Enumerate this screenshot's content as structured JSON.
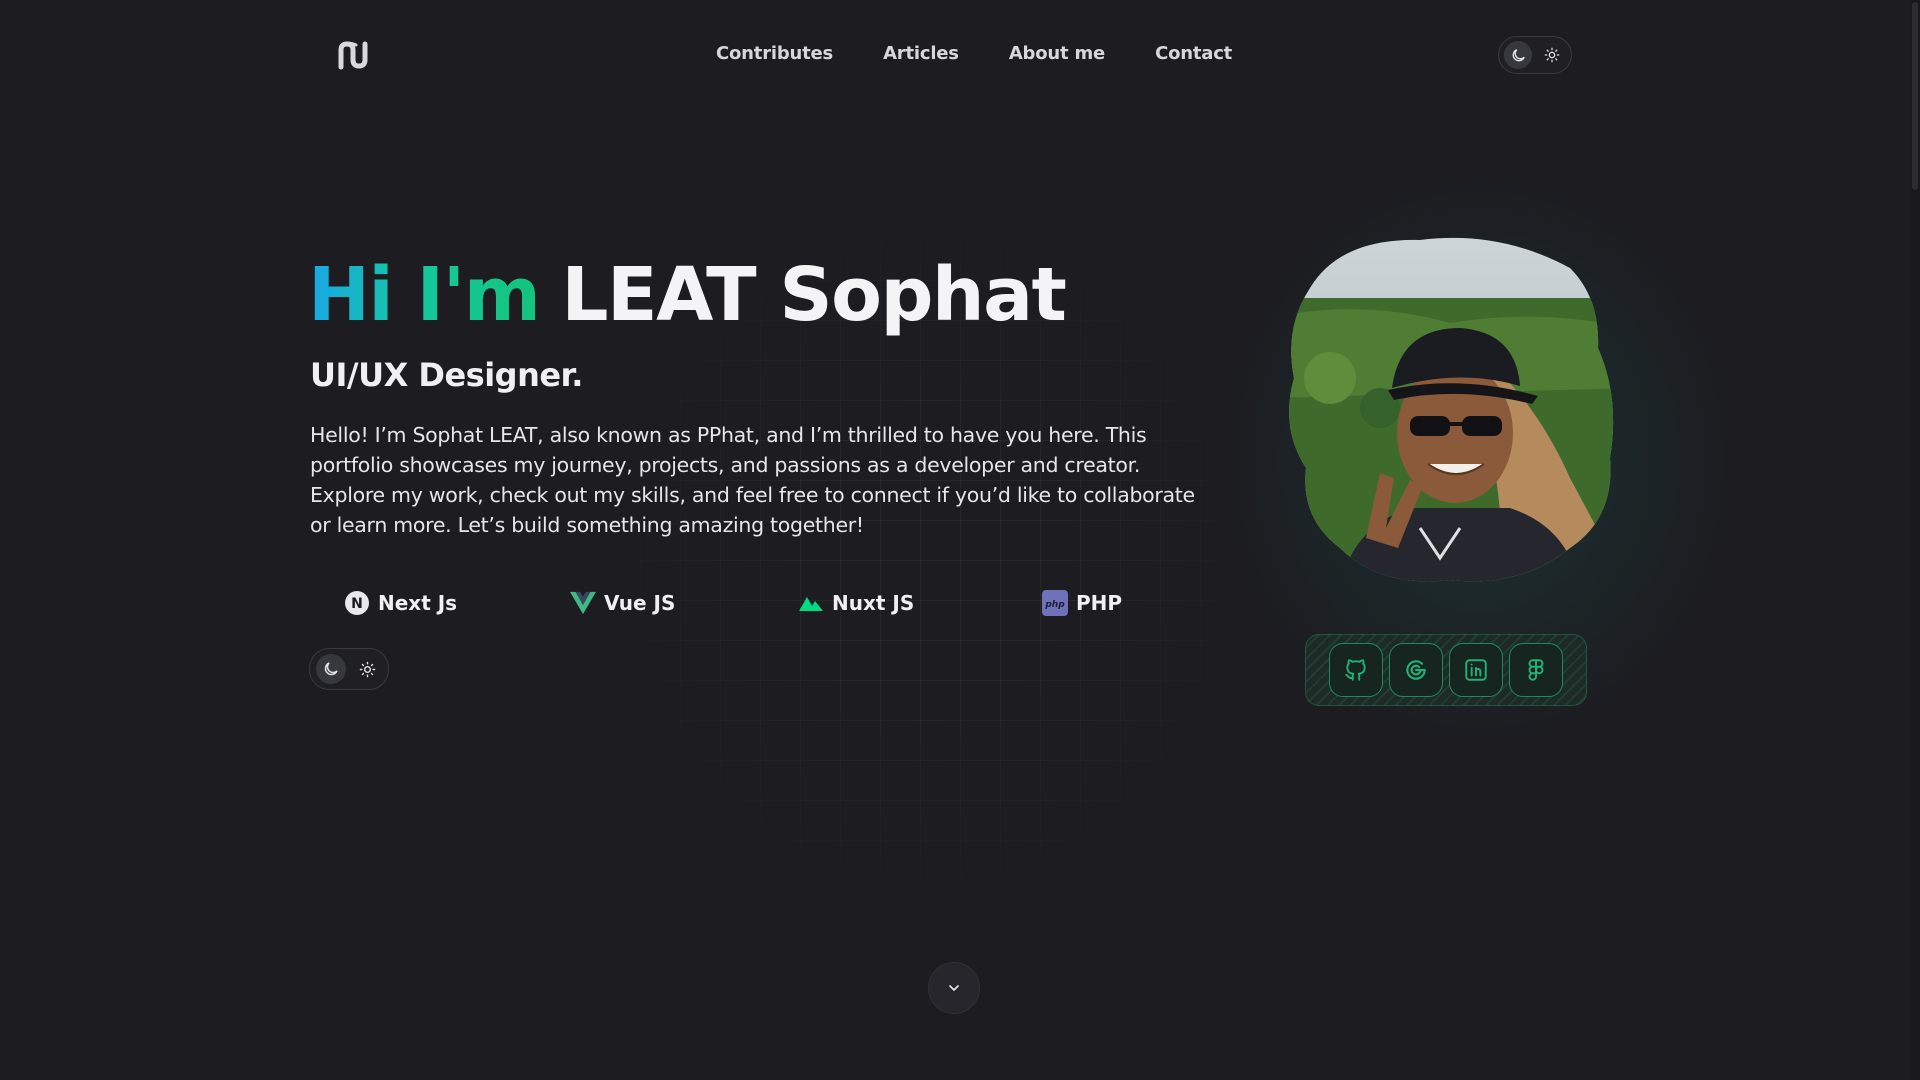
{
  "header": {
    "nav": [
      {
        "label": "Contributes"
      },
      {
        "label": "Articles"
      },
      {
        "label": "About me"
      },
      {
        "label": "Contact"
      }
    ],
    "theme_toggle": {
      "options": [
        "moon-icon",
        "sun-icon"
      ],
      "active": "moon-icon"
    }
  },
  "hero": {
    "greeting": "Hi I'm",
    "name": "LEAT Sophat",
    "role": "UI/UX Designer.",
    "intro": "Hello! I’m Sophat LEAT, also known as PPhat, and I’m thrilled to have you here. This portfolio showcases my journey, projects, and passions as a developer and creator. Explore my work, check out my skills, and feel free to connect if you’d like to collaborate or learn more. Let’s build something amazing together!",
    "tech": [
      {
        "label": "Next Js",
        "icon": "nextjs-icon"
      },
      {
        "label": "Vue JS",
        "icon": "vuejs-icon"
      },
      {
        "label": "Nuxt JS",
        "icon": "nuxtjs-icon"
      },
      {
        "label": "PHP",
        "icon": "php-icon"
      }
    ]
  },
  "social": [
    {
      "icon": "github-icon"
    },
    {
      "icon": "google-icon"
    },
    {
      "icon": "linkedin-icon"
    },
    {
      "icon": "figma-icon"
    }
  ],
  "colors": {
    "background": "#1c1c21",
    "accent_blue": "#19a7e6",
    "accent_green": "#14c47a",
    "social_green": "#1f8a5e"
  }
}
